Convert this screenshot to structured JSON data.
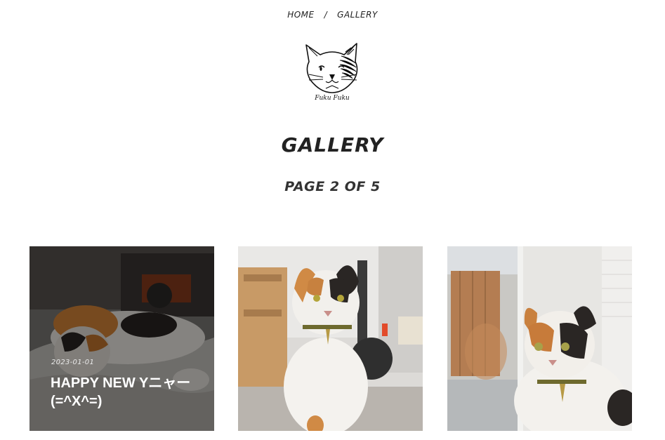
{
  "breadcrumb": {
    "home": "HOME",
    "separator": "/",
    "current": "GALLERY"
  },
  "logo": {
    "icon": "cat-face-logo",
    "text": "Fuku Fuku"
  },
  "heading": {
    "title": "GALLERY",
    "pagination": "PAGE 2 OF 5"
  },
  "cards": [
    {
      "date": "2023-01-01",
      "title": "HAPPY NEW Yニャー (=^X^=)",
      "image": "calico-cat-lying-photo"
    },
    {
      "image": "calico-cat-sitting-photo"
    },
    {
      "image": "calico-cat-window-photo"
    }
  ]
}
